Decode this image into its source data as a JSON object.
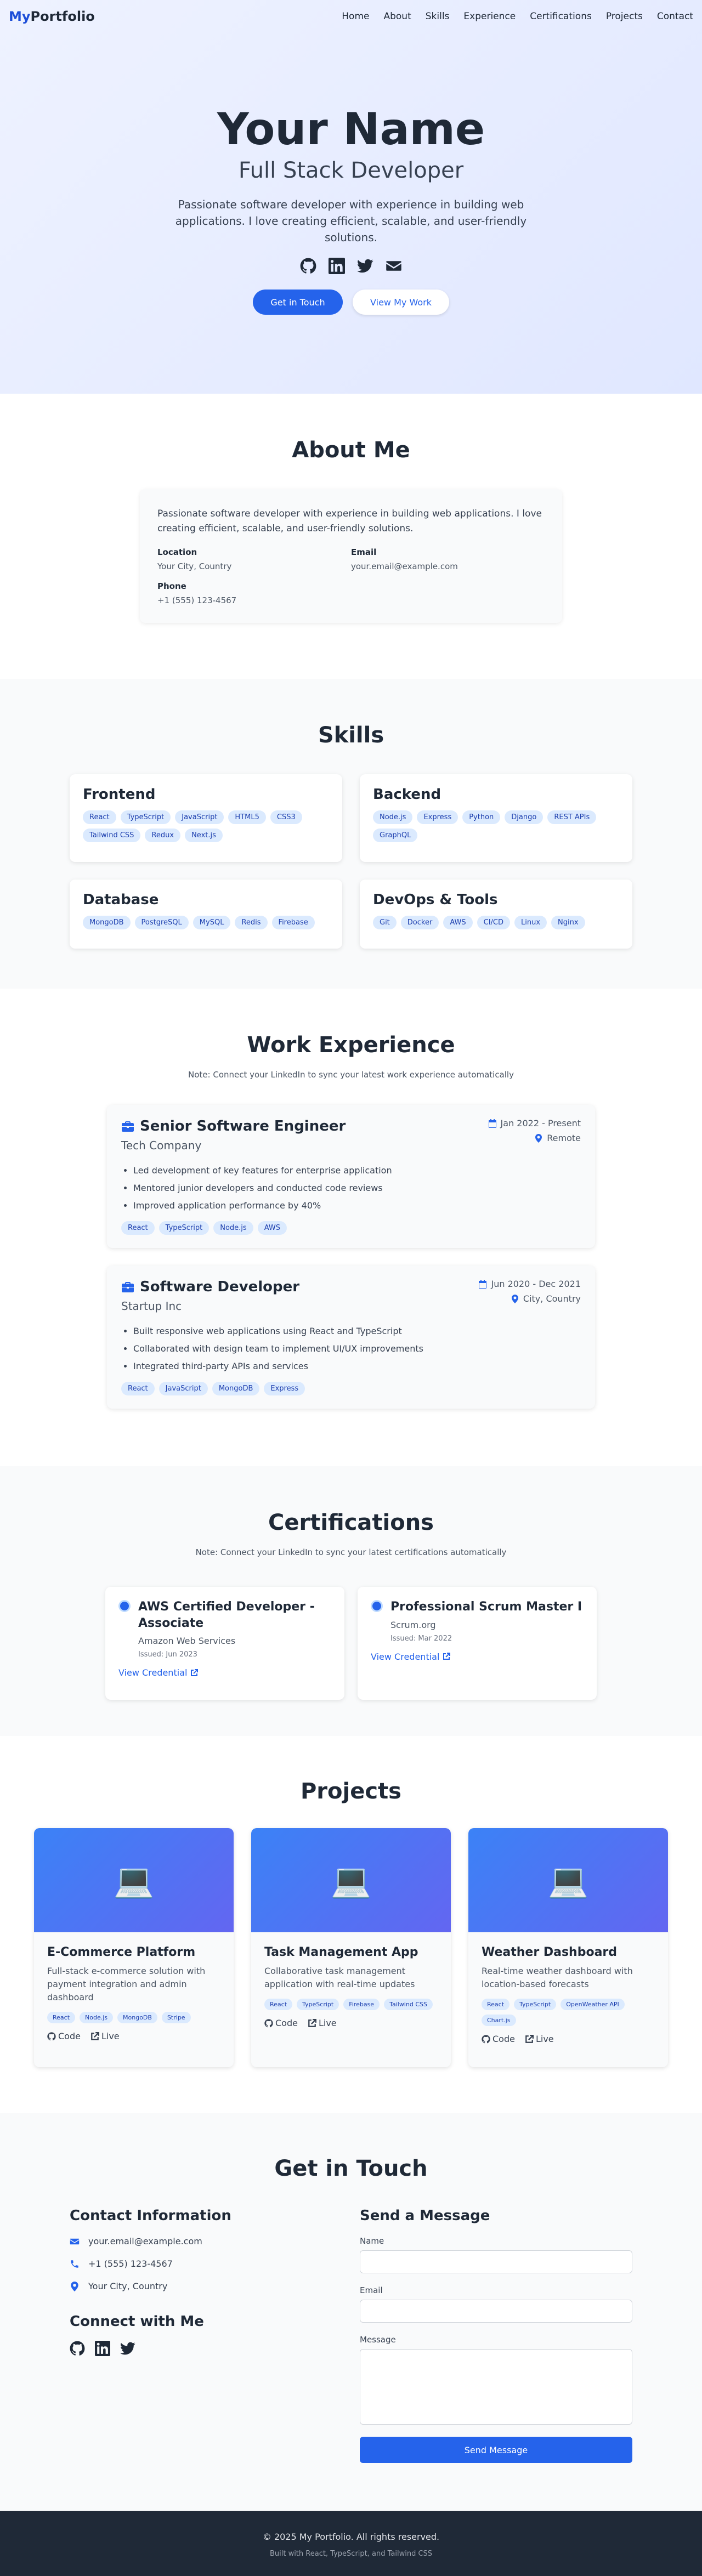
{
  "nav": {
    "brand_a": "My",
    "brand_b": "Portfolio",
    "items": [
      "Home",
      "About",
      "Skills",
      "Experience",
      "Certifications",
      "Projects",
      "Contact"
    ]
  },
  "hero": {
    "name": "Your Name",
    "role": "Full Stack Developer",
    "bio": "Passionate software developer with experience in building web applications. I love creating efficient, scalable, and user-friendly solutions.",
    "social_icons": [
      "github-icon",
      "linkedin-icon",
      "twitter-icon",
      "envelope-icon"
    ],
    "primary_button": "Get in Touch",
    "secondary_button": "View My Work"
  },
  "about": {
    "title": "About Me",
    "bio": "Passionate software developer with experience in building web applications. I love creating efficient, scalable, and user-friendly solutions.",
    "location_label": "Location",
    "location": "Your City, Country",
    "email_label": "Email",
    "email": "your.email@example.com",
    "phone_label": "Phone",
    "phone": "+1 (555) 123-4567"
  },
  "skills": {
    "title": "Skills",
    "groups": [
      {
        "name": "Frontend",
        "items": [
          "React",
          "TypeScript",
          "JavaScript",
          "HTML5",
          "CSS3",
          "Tailwind CSS",
          "Redux",
          "Next.js"
        ]
      },
      {
        "name": "Backend",
        "items": [
          "Node.js",
          "Express",
          "Python",
          "Django",
          "REST APIs",
          "GraphQL"
        ]
      },
      {
        "name": "Database",
        "items": [
          "MongoDB",
          "PostgreSQL",
          "MySQL",
          "Redis",
          "Firebase"
        ]
      },
      {
        "name": "DevOps & Tools",
        "items": [
          "Git",
          "Docker",
          "AWS",
          "CI/CD",
          "Linux",
          "Nginx"
        ]
      }
    ]
  },
  "experience": {
    "title": "Work Experience",
    "note": "Note: Connect your LinkedIn to sync your latest work experience automatically",
    "jobs": [
      {
        "title": "Senior Software Engineer",
        "company": "Tech Company",
        "dates": "Jan 2022 - Present",
        "location": "Remote",
        "bullets": [
          "Led development of key features for enterprise application",
          "Mentored junior developers and conducted code reviews",
          "Improved application performance by 40%"
        ],
        "tags": [
          "React",
          "TypeScript",
          "Node.js",
          "AWS"
        ]
      },
      {
        "title": "Software Developer",
        "company": "Startup Inc",
        "dates": "Jun 2020 - Dec 2021",
        "location": "City, Country",
        "bullets": [
          "Built responsive web applications using React and TypeScript",
          "Collaborated with design team to implement UI/UX improvements",
          "Integrated third-party APIs and services"
        ],
        "tags": [
          "React",
          "JavaScript",
          "MongoDB",
          "Express"
        ]
      }
    ]
  },
  "certifications": {
    "title": "Certifications",
    "note": "Note: Connect your LinkedIn to sync your latest certifications automatically",
    "items": [
      {
        "name": "AWS Certified Developer - Associate",
        "issuer": "Amazon Web Services",
        "issued": "Issued: Jun 2023",
        "link": "View Credential"
      },
      {
        "name": "Professional Scrum Master I",
        "issuer": "Scrum.org",
        "issued": "Issued: Mar 2022",
        "link": "View Credential"
      }
    ]
  },
  "projects": {
    "title": "Projects",
    "code_label": "Code",
    "live_label": "Live",
    "items": [
      {
        "name": "E-Commerce Platform",
        "desc": "Full-stack e-commerce solution with payment integration and admin dashboard",
        "tags": [
          "React",
          "Node.js",
          "MongoDB",
          "Stripe"
        ]
      },
      {
        "name": "Task Management App",
        "desc": "Collaborative task management application with real-time updates",
        "tags": [
          "React",
          "TypeScript",
          "Firebase",
          "Tailwind CSS"
        ]
      },
      {
        "name": "Weather Dashboard",
        "desc": "Real-time weather dashboard with location-based forecasts",
        "tags": [
          "React",
          "TypeScript",
          "OpenWeather API",
          "Chart.js"
        ]
      }
    ]
  },
  "contact": {
    "title": "Get in Touch",
    "info_title": "Contact Information",
    "email": "your.email@example.com",
    "phone": "+1 (555) 123-4567",
    "location": "Your City, Country",
    "connect_title": "Connect with Me",
    "form_title": "Send a Message",
    "name_label": "Name",
    "email_label": "Email",
    "message_label": "Message",
    "submit": "Send Message"
  },
  "footer": {
    "copyright": "© 2025 My Portfolio. All rights reserved.",
    "built_with": "Built with React, TypeScript, and Tailwind CSS"
  },
  "colors": {
    "accent": "#2563eb",
    "tag_bg": "#dbeafe",
    "footer_bg": "#1f2937"
  }
}
